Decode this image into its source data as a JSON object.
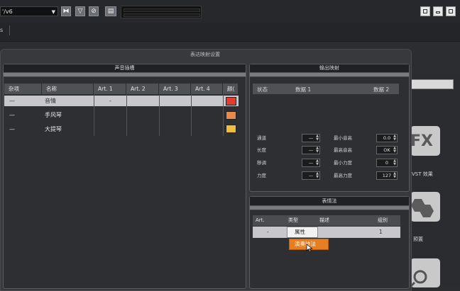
{
  "toolbar": {
    "track_name": "'/v6",
    "tool_icons": [
      "squash-icon",
      "filter-icon",
      "circle-slash-icon",
      "keyboard-icon"
    ],
    "window_buttons": [
      "restore-icon",
      "minimize-icon",
      "maximize-icon"
    ]
  },
  "row2": {
    "label": "s"
  },
  "dialog": {
    "title": "表达映射设置"
  },
  "sound_slots": {
    "title": "声音插槽",
    "columns": [
      "杂项",
      "名称",
      "Art. 1",
      "Art. 2",
      "Art. 3",
      "Art. 4",
      "颜("
    ],
    "rows": [
      {
        "misc": "—",
        "name": "音情",
        "art1": "-",
        "color": "#e53a2e"
      },
      {
        "misc": "—",
        "name": "手风琴",
        "art1": "",
        "color": "#e9894a"
      },
      {
        "misc": "—",
        "name": "大提琴",
        "art1": "",
        "color": "#f0be3e"
      }
    ]
  },
  "output_mapping": {
    "title": "输出映射",
    "columns": [
      "状态",
      "数据 1",
      "数据 2"
    ],
    "left_fields": [
      {
        "label": "通道",
        "value": "—"
      },
      {
        "label": "长度",
        "value": "—"
      },
      {
        "label": "移调",
        "value": "—"
      },
      {
        "label": "力度",
        "value": "—"
      }
    ],
    "right_fields": [
      {
        "label": "最小音高",
        "value": "0.0"
      },
      {
        "label": "最高音高",
        "value": "OK"
      },
      {
        "label": "最小力度",
        "value": "0"
      },
      {
        "label": "最高力度",
        "value": "127"
      }
    ]
  },
  "articulations": {
    "title": "表情法",
    "columns": [
      "Art.",
      "类型",
      "描述",
      "组别"
    ],
    "row": {
      "art": "-",
      "type": "属性",
      "desc": "",
      "group": "1"
    },
    "dropdown": {
      "options": [
        "属性",
        "演奏技法"
      ],
      "highlighted": "演奏技法"
    }
  },
  "sidebar": {
    "items": [
      {
        "icon_text": "FX",
        "label": "VST 效果"
      },
      {
        "icon_text": "",
        "label": "预置"
      },
      {
        "icon_text": "",
        "label": ""
      }
    ]
  },
  "colors": {
    "accent_orange": "#e67e22",
    "panel_bg": "#2e2f32",
    "header_bg": "#505155"
  }
}
